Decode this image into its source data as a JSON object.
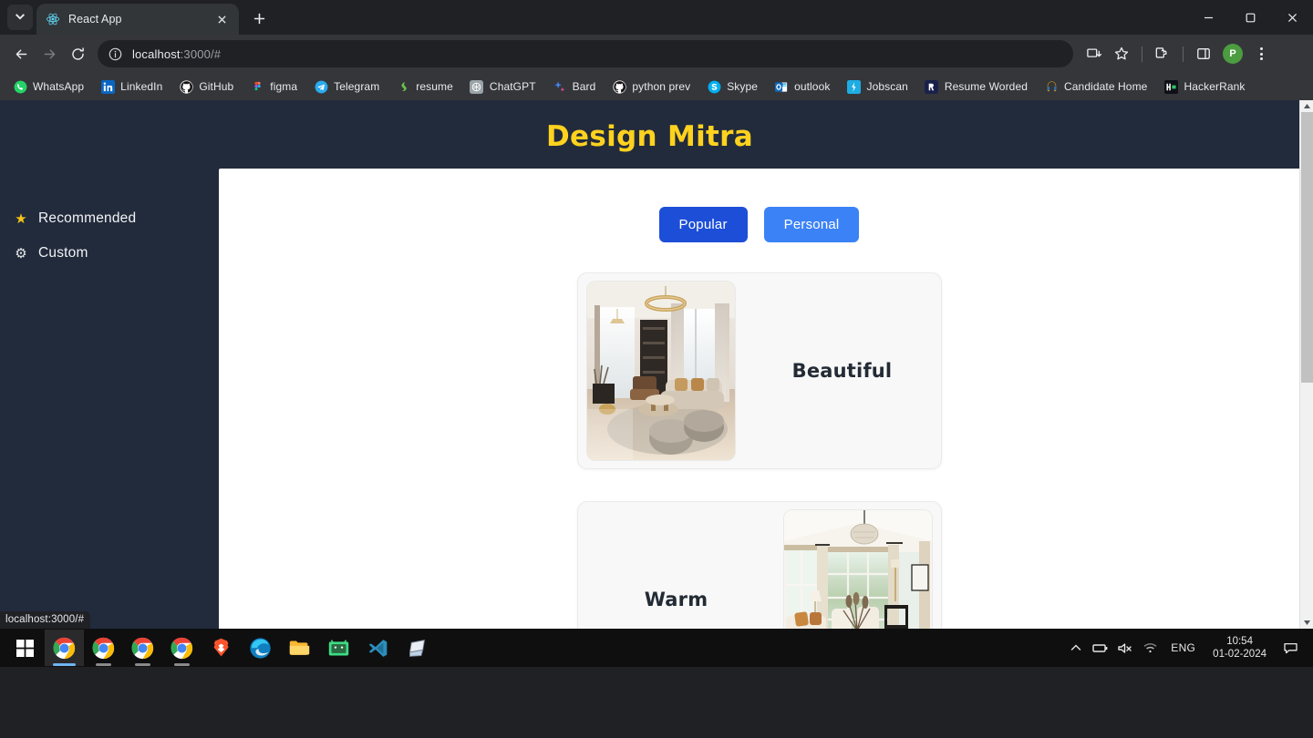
{
  "browser": {
    "tab": {
      "title": "React App",
      "favicon_icon": "react-logo-icon"
    },
    "tab_search_icon": "chevron-down-icon",
    "new_tab_icon": "plus-icon",
    "window_controls": {
      "minimize": "minimize-icon",
      "maximize": "maximize-icon",
      "close": "close-icon"
    },
    "nav": {
      "back_icon": "arrow-left-icon",
      "forward_icon": "arrow-right-icon",
      "reload_icon": "reload-icon"
    },
    "omnibox": {
      "info_icon": "site-info-icon",
      "url_host": "localhost",
      "url_rest": ":3000/#",
      "full_url": "localhost:3000/#"
    },
    "toolbar_icons": [
      "install-app-icon",
      "bookmark-star-icon",
      "extensions-puzzle-icon",
      "side-panel-icon"
    ],
    "profile": {
      "initial": "P",
      "color": "#4c9c40"
    },
    "menu_icon": "kebab-menu-icon",
    "bookmarks": [
      {
        "label": "WhatsApp",
        "icon": "whatsapp-icon"
      },
      {
        "label": "LinkedIn",
        "icon": "linkedin-icon"
      },
      {
        "label": "GitHub",
        "icon": "github-icon"
      },
      {
        "label": "figma",
        "icon": "figma-icon"
      },
      {
        "label": "Telegram",
        "icon": "telegram-icon"
      },
      {
        "label": "resume",
        "icon": "resume-icon"
      },
      {
        "label": "ChatGPT",
        "icon": "chatgpt-icon"
      },
      {
        "label": "Bard",
        "icon": "bard-sparkle-icon"
      },
      {
        "label": "python prev",
        "icon": "github-icon"
      },
      {
        "label": "Skype",
        "icon": "skype-icon"
      },
      {
        "label": "outlook",
        "icon": "outlook-icon"
      },
      {
        "label": "Jobscan",
        "icon": "jobscan-icon"
      },
      {
        "label": "Resume Worded",
        "icon": "resume-worded-icon"
      },
      {
        "label": "Candidate Home",
        "icon": "candidate-home-icon"
      },
      {
        "label": "HackerRank",
        "icon": "hackerrank-icon"
      }
    ],
    "status_bubble": "localhost:3000/#"
  },
  "app": {
    "title": "Design Mitra",
    "title_color": "#ffd21e",
    "background_color": "#222b3c",
    "sidebar": {
      "items": [
        {
          "label": "Recommended",
          "icon": "star-icon",
          "glyph": "★",
          "color": "#f5c518"
        },
        {
          "label": "Custom",
          "icon": "gear-icon",
          "glyph": "⚙",
          "color": "#e8e8e8"
        }
      ]
    },
    "tabs": [
      {
        "label": "Popular",
        "active": true,
        "color": "#1d4ed8"
      },
      {
        "label": "Personal",
        "active": false,
        "color": "#3b82f6"
      }
    ],
    "cards": [
      {
        "title": "Beautiful",
        "image_position": "left",
        "image_alt": "luxury-living-room-with-chandelier"
      },
      {
        "title": "Warm",
        "image_position": "right",
        "image_alt": "bright-sunroom-with-white-furniture"
      }
    ],
    "scrollbar": {
      "up_arrow_icon": "caret-up-icon",
      "down_arrow_icon": "caret-down-icon"
    }
  },
  "taskbar": {
    "start_icon": "windows-start-icon",
    "apps": [
      {
        "name": "chrome-profile-p",
        "icon": "chrome-icon",
        "active": true
      },
      {
        "name": "chrome-profile-2",
        "icon": "chrome-icon",
        "active": false
      },
      {
        "name": "chrome-profile-3",
        "icon": "chrome-icon",
        "active": false
      },
      {
        "name": "chrome-profile-a",
        "icon": "chrome-icon",
        "active": false
      },
      {
        "name": "brave-browser",
        "icon": "brave-icon",
        "active": false
      },
      {
        "name": "microsoft-edge",
        "icon": "edge-icon",
        "active": false
      },
      {
        "name": "file-explorer",
        "icon": "folder-icon",
        "active": false
      },
      {
        "name": "android-studio",
        "icon": "android-studio-icon",
        "active": false
      },
      {
        "name": "vs-code",
        "icon": "vscode-icon",
        "active": false
      },
      {
        "name": "snipping-tool",
        "icon": "snipping-tool-icon",
        "active": false
      }
    ],
    "tray": {
      "overflow_icon": "chevron-up-icon",
      "battery_icon": "battery-icon",
      "volume_icon": "volume-muted-icon",
      "wifi_icon": "wifi-icon",
      "language": "ENG",
      "time": "10:54",
      "date": "01-02-2024",
      "notifications_icon": "notification-icon"
    }
  }
}
